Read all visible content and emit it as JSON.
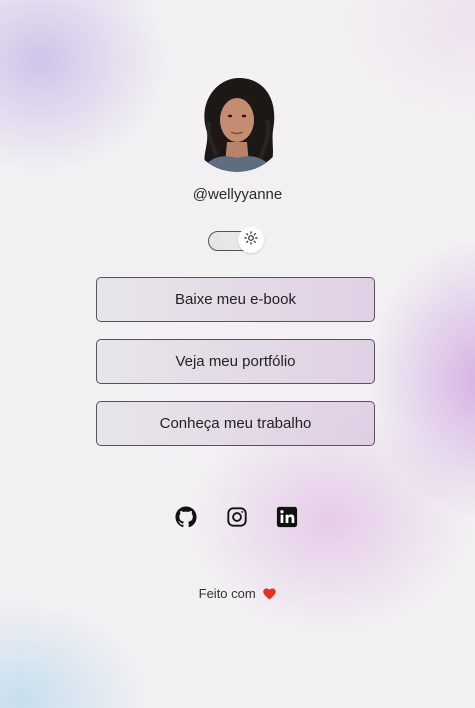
{
  "profile": {
    "username": "@wellyyanne",
    "avatar_alt": "profile photo"
  },
  "theme_toggle": {
    "state": "light",
    "icon": "sun-icon"
  },
  "links": [
    {
      "label": "Baixe meu e-book"
    },
    {
      "label": "Veja meu portfólio"
    },
    {
      "label": "Conheça meu trabalho"
    }
  ],
  "social": [
    {
      "icon": "github-icon"
    },
    {
      "icon": "instagram-icon"
    },
    {
      "icon": "linkedin-icon"
    }
  ],
  "footer": {
    "text": "Feito com",
    "heart_color": "#e0332b"
  },
  "colors": {
    "button_border": "#555555",
    "text": "#222222"
  }
}
